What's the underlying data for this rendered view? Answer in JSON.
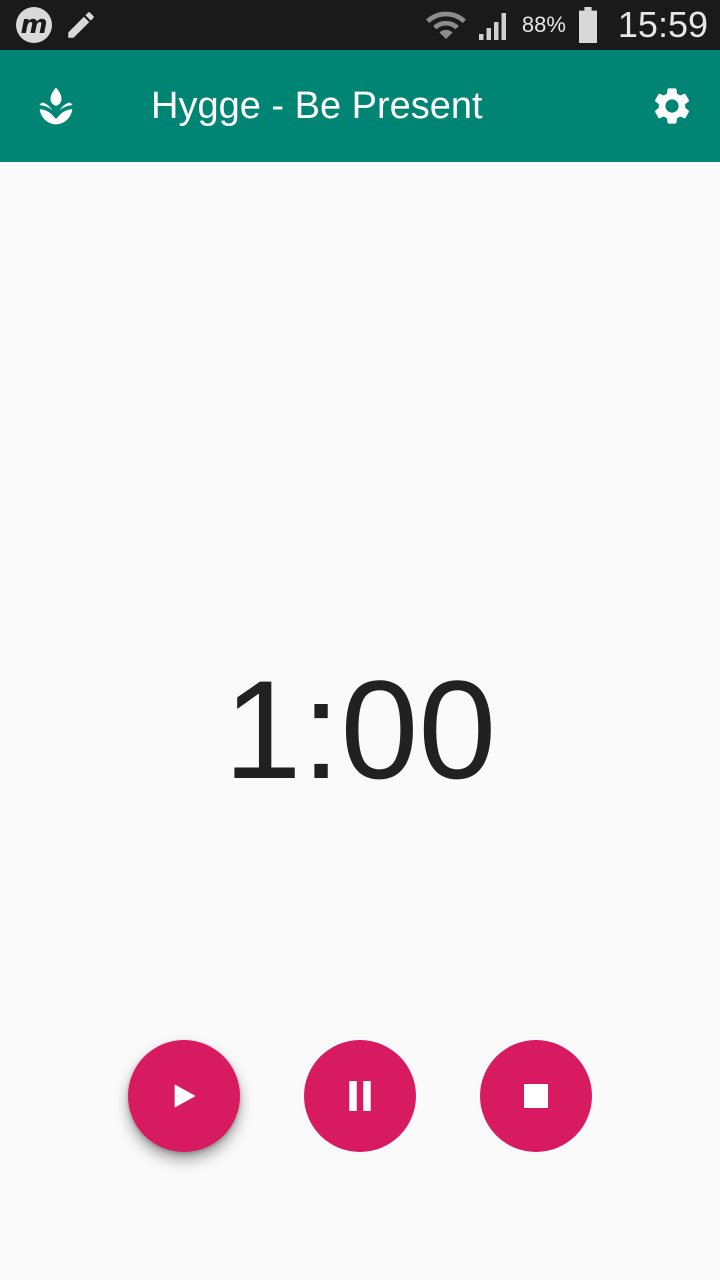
{
  "status_bar": {
    "battery": "88%",
    "time": "15:59",
    "icons": [
      "m-app-icon",
      "pencil-icon",
      "wifi-icon",
      "signal-icon",
      "battery-icon"
    ]
  },
  "app_bar": {
    "title": "Hygge - Be Present",
    "logo_icon": "lotus-icon",
    "settings_icon": "gear-icon",
    "background": "#008473"
  },
  "timer": {
    "display": "1:00"
  },
  "controls": {
    "accent": "#d81b60",
    "buttons": [
      {
        "name": "play",
        "icon": "play-icon"
      },
      {
        "name": "pause",
        "icon": "pause-icon"
      },
      {
        "name": "stop",
        "icon": "stop-icon"
      }
    ]
  }
}
